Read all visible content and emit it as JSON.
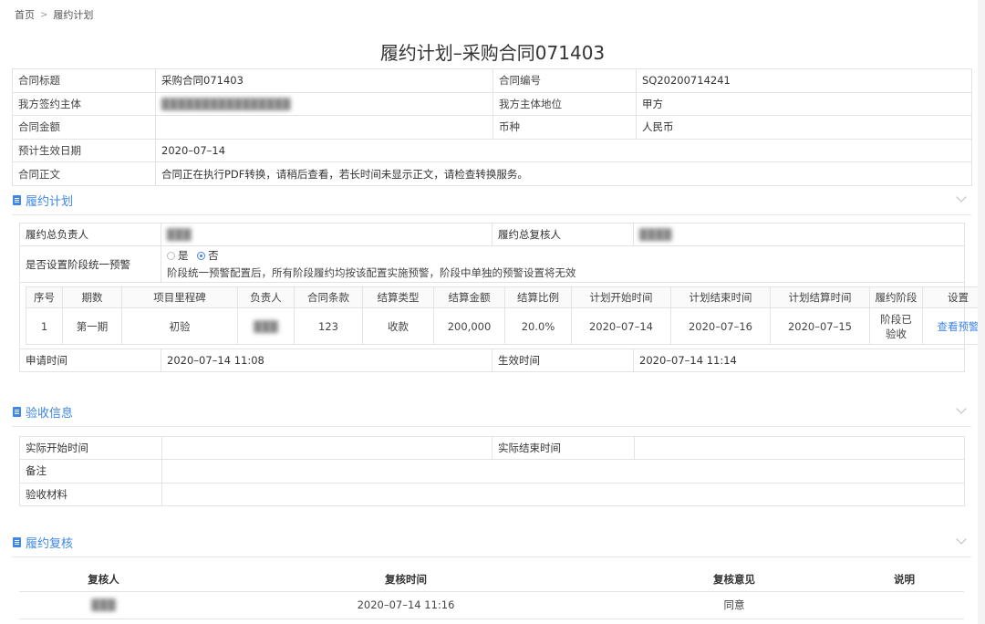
{
  "breadcrumb": {
    "home": "首页",
    "sep": ">",
    "current": "履约计划"
  },
  "page_title": "履约计划–采购合同071403",
  "contract": {
    "title_label": "合同标题",
    "title_value": "采购合同071403",
    "no_label": "合同编号",
    "no_value": "SQ20200714241",
    "party_label": "我方签约主体",
    "party_value": "",
    "position_label": "我方主体地位",
    "position_value": "甲方",
    "amount_label": "合同金额",
    "amount_value": "",
    "currency_label": "币种",
    "currency_value": "人民币",
    "effective_date_label": "预计生效日期",
    "effective_date_value": "2020–07–14",
    "body_label": "合同正文",
    "body_value": "合同正在执行PDF转换，请稍后查看，若长时间未显示正文，请检查转换服务。"
  },
  "plan_section": {
    "title": "履约计划",
    "owner_label": "履约总负责人",
    "owner_value": "",
    "reviewer_label": "履约总复核人",
    "reviewer_value": "",
    "warn_label": "是否设置阶段统一预警",
    "warn_yes": "是",
    "warn_no": "否",
    "warn_selected": "否",
    "warn_note": "阶段统一预警配置后，所有阶段履约均按该配置实施预警，阶段中单独的预警设置将无效",
    "columns": [
      "序号",
      "期数",
      "项目里程碑",
      "负责人",
      "合同条款",
      "结算类型",
      "结算金额",
      "结算比例",
      "计划开始时间",
      "计划结束时间",
      "计划结算时间",
      "履约阶段",
      "设置"
    ],
    "rows": [
      {
        "index": "1",
        "period": "第一期",
        "milestone": "初验",
        "owner": "",
        "clause": "123",
        "settle_type": "收款",
        "amount": "200,000",
        "ratio": "20.0%",
        "plan_start": "2020–07–14",
        "plan_end": "2020–07–16",
        "plan_settle": "2020–07–15",
        "stage": "阶段已验收",
        "action": "查看预警"
      }
    ],
    "apply_time_label": "申请时间",
    "apply_time_value": "2020–07–14 11:08",
    "effective_time_label": "生效时间",
    "effective_time_value": "2020–07–14 11:14"
  },
  "acceptance_section": {
    "title": "验收信息",
    "actual_start_label": "实际开始时间",
    "actual_start_value": "",
    "actual_end_label": "实际结束时间",
    "actual_end_value": "",
    "remark_label": "备注",
    "remark_value": "",
    "material_label": "验收材料",
    "material_value": ""
  },
  "review_section": {
    "title": "履约复核",
    "columns": [
      "复核人",
      "复核时间",
      "复核意见",
      "说明"
    ],
    "rows": [
      {
        "reviewer": "",
        "time": "2020–07–14 11:16",
        "opinion": "同意",
        "note": ""
      }
    ]
  },
  "colors": {
    "accent": "#3e86e8",
    "border": "#e3e3e3"
  }
}
